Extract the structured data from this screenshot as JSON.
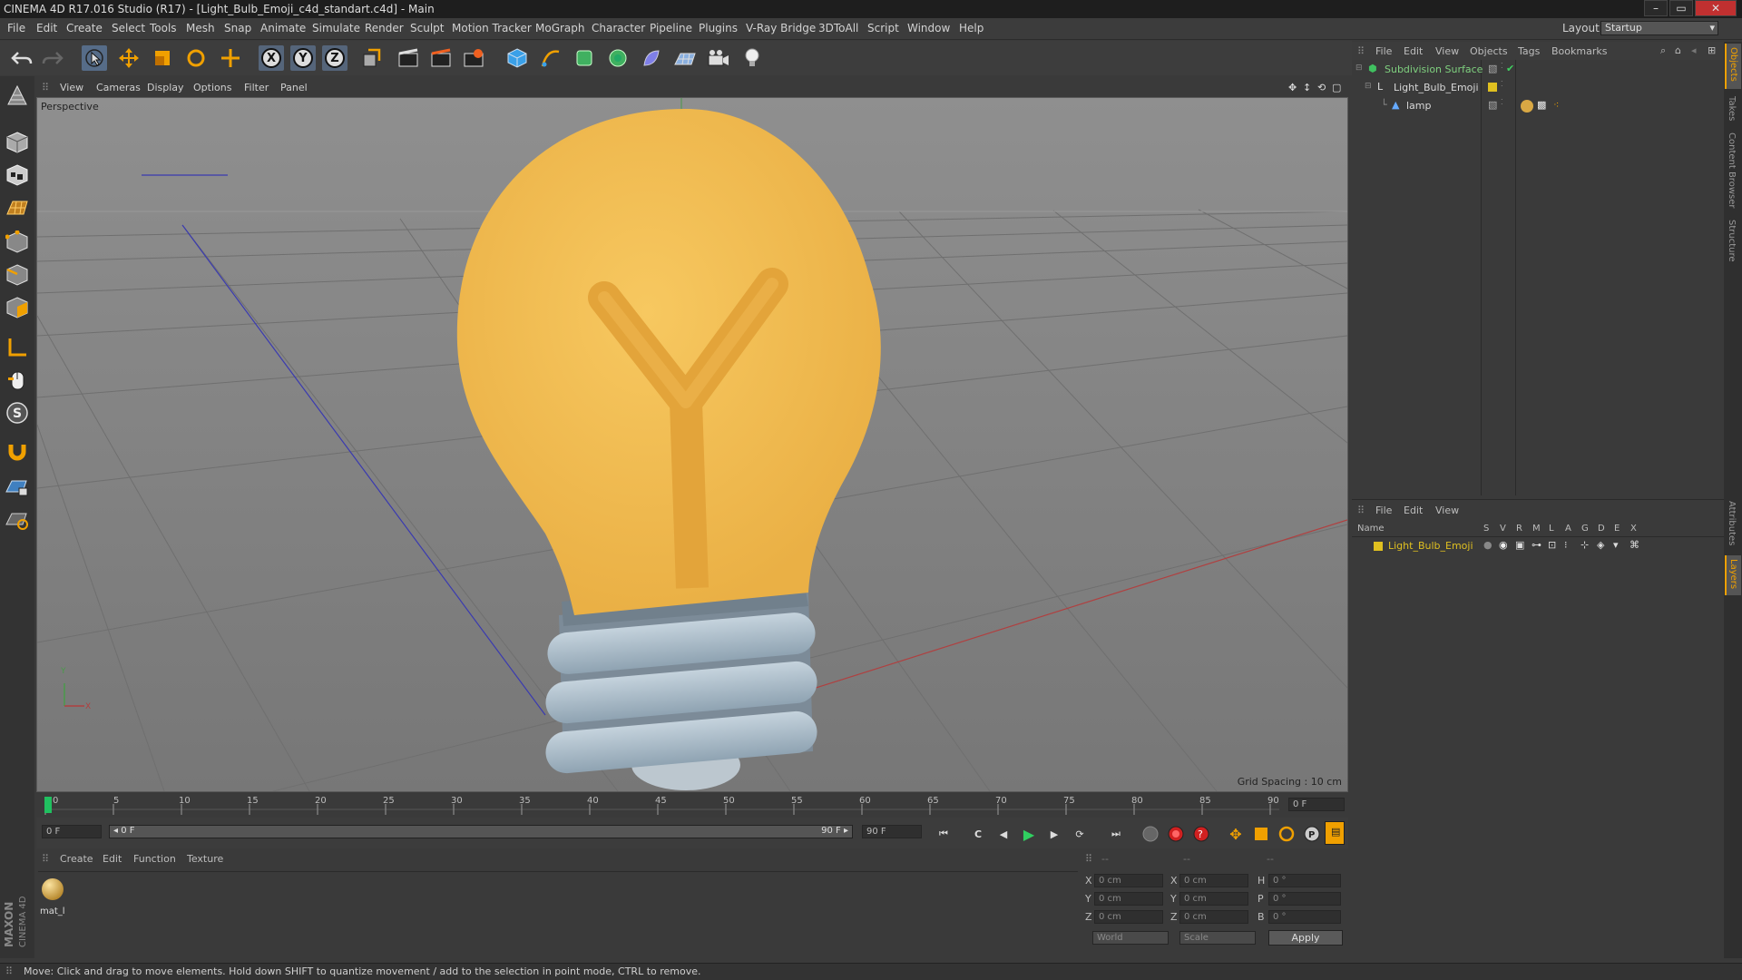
{
  "window": {
    "title": "CINEMA 4D R17.016 Studio (R17) - [Light_Bulb_Emoji_c4d_standart.c4d] - Main",
    "min": "–",
    "max": "▭",
    "close": "✕"
  },
  "menu": [
    "File",
    "Edit",
    "Create",
    "Select",
    "Tools",
    "Mesh",
    "Snap",
    "Animate",
    "Simulate",
    "Render",
    "Sculpt",
    "Motion Tracker",
    "MoGraph",
    "Character",
    "Pipeline",
    "Plugins",
    "V-Ray Bridge",
    "3DToAll",
    "Script",
    "Window",
    "Help"
  ],
  "layout": {
    "label": "Layout:",
    "value": "Startup"
  },
  "toolbar": {
    "x_label": "X",
    "y_label": "Y",
    "z_label": "Z"
  },
  "viewport": {
    "menu": [
      "View",
      "Cameras",
      "Display",
      "Options",
      "Filter",
      "Panel"
    ],
    "camera_label": "Perspective",
    "grid_spacing": "Grid Spacing : 10 cm",
    "axis_y": "Y",
    "axis_x": "X"
  },
  "timeline": {
    "ticks": [
      "0",
      "5",
      "10",
      "15",
      "20",
      "25",
      "30",
      "35",
      "40",
      "45",
      "50",
      "55",
      "60",
      "65",
      "70",
      "75",
      "80",
      "85",
      "90"
    ],
    "current_frame": "0 F",
    "start_field": "0 F",
    "range_start": "◂ 0 F",
    "range_end": "90 F ▸",
    "end_field": "90 F"
  },
  "materials": {
    "menu": [
      "Create",
      "Edit",
      "Function",
      "Texture"
    ],
    "items": [
      {
        "name": "mat_l"
      }
    ]
  },
  "coordinates": {
    "header": [
      "--",
      "--",
      "--"
    ],
    "rows": [
      {
        "a": "X",
        "av": "0 cm",
        "b": "X",
        "bv": "0 cm",
        "c": "H",
        "cv": "0 °"
      },
      {
        "a": "Y",
        "av": "0 cm",
        "b": "Y",
        "bv": "0 cm",
        "c": "P",
        "cv": "0 °"
      },
      {
        "a": "Z",
        "av": "0 cm",
        "b": "Z",
        "bv": "0 cm",
        "c": "B",
        "cv": "0 °"
      }
    ],
    "world": "World",
    "scale": "Scale",
    "apply": "Apply"
  },
  "objects": {
    "menu": [
      "File",
      "Edit",
      "View",
      "Objects",
      "Tags",
      "Bookmarks"
    ],
    "tree": [
      {
        "name": "Subdivision Surface",
        "color": "#7fd07f"
      },
      {
        "name": "Light_Bulb_Emoji",
        "color": "#d9d9d9"
      },
      {
        "name": "lamp",
        "color": "#d9d9d9"
      }
    ]
  },
  "layers": {
    "menu": [
      "File",
      "Edit",
      "View"
    ],
    "columns": [
      "Name",
      "S",
      "V",
      "R",
      "M",
      "L",
      "A",
      "G",
      "D",
      "E",
      "X"
    ],
    "items": [
      {
        "name": "Light_Bulb_Emoji",
        "color": "#e0c020"
      }
    ]
  },
  "side_tabs": [
    "Objects",
    "Takes",
    "Content Browser",
    "Structure",
    "Attributes",
    "Layers"
  ],
  "brand": {
    "maxon": "MAXON",
    "product": "CINEMA 4D"
  },
  "status": "Move: Click and drag to move elements. Hold down SHIFT to quantize movement / add to the selection in point mode, CTRL to remove."
}
